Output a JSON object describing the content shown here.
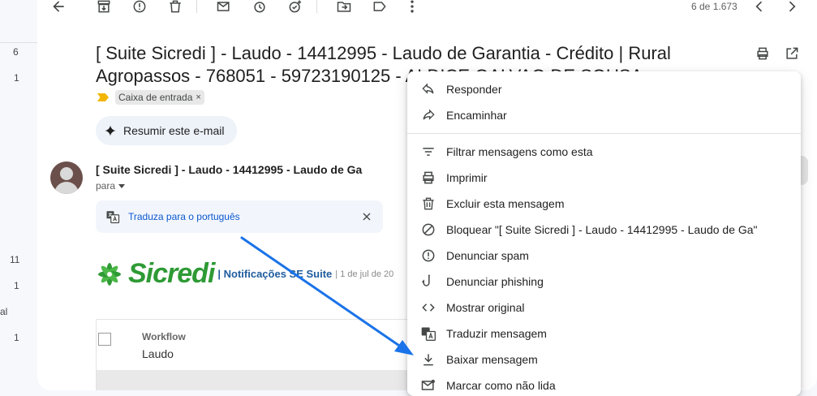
{
  "left_counts": [
    "6",
    "1",
    "11",
    "1",
    "1"
  ],
  "left_cut_text": "al",
  "toolbar": {
    "page_count": "6 de 1.673",
    "icons": [
      "back-arrow-icon",
      "archive-icon",
      "report-spam-icon",
      "delete-icon",
      "mark-unread-icon",
      "snooze-icon",
      "add-task-icon",
      "move-to-icon",
      "label-icon",
      "more-vert-icon",
      "prev-icon",
      "next-icon"
    ]
  },
  "email": {
    "subject_line1": "[ Suite Sicredi ] - Laudo - 14412995 - Laudo de Garantia - Crédito | Rural",
    "subject_line2": "Agropassos - 768051 - 59723190125 - ALDICE GALVAO DE SOUSA",
    "label_chip": "Caixa de entrada",
    "chip_close": "×",
    "summarize": "Resumir este e-mail",
    "sender_truncated": "[ Suite Sicredi ] - Laudo - 14412995 - Laudo de Ga",
    "para": "para",
    "translate_link": "Traduza para o português"
  },
  "body": {
    "logo_word": "Sicredi",
    "notif_label": "| Notificações SE Suite",
    "date_text": "| 1 de jul de 20",
    "workflow_title": "Workflow",
    "workflow_sub": "Laudo"
  },
  "menu": {
    "items": [
      {
        "label": "Responder",
        "icon": "reply-icon"
      },
      {
        "label": "Encaminhar",
        "icon": "forward-icon"
      },
      {
        "label": "Filtrar mensagens como esta",
        "icon": "filter-icon"
      },
      {
        "label": "Imprimir",
        "icon": "print-icon"
      },
      {
        "label": "Excluir esta mensagem",
        "icon": "trash-icon"
      },
      {
        "label": "Bloquear \"[ Suite Sicredi ] - Laudo - 14412995 - Laudo de Ga\"",
        "icon": "block-icon"
      },
      {
        "label": "Denunciar spam",
        "icon": "report-icon"
      },
      {
        "label": "Denunciar phishing",
        "icon": "phishing-hook-icon"
      },
      {
        "label": "Mostrar original",
        "icon": "code-icon"
      },
      {
        "label": "Traduzir mensagem",
        "icon": "translate-icon"
      },
      {
        "label": "Baixar mensagem",
        "icon": "download-icon"
      },
      {
        "label": "Marcar como não lida",
        "icon": "mark-unread-icon"
      }
    ]
  },
  "colors": {
    "accent_blue": "#0b57d0",
    "arrow_blue": "#1a73e8",
    "sicredi_green": "#2e9a35",
    "important_yellow": "#f2b600"
  }
}
